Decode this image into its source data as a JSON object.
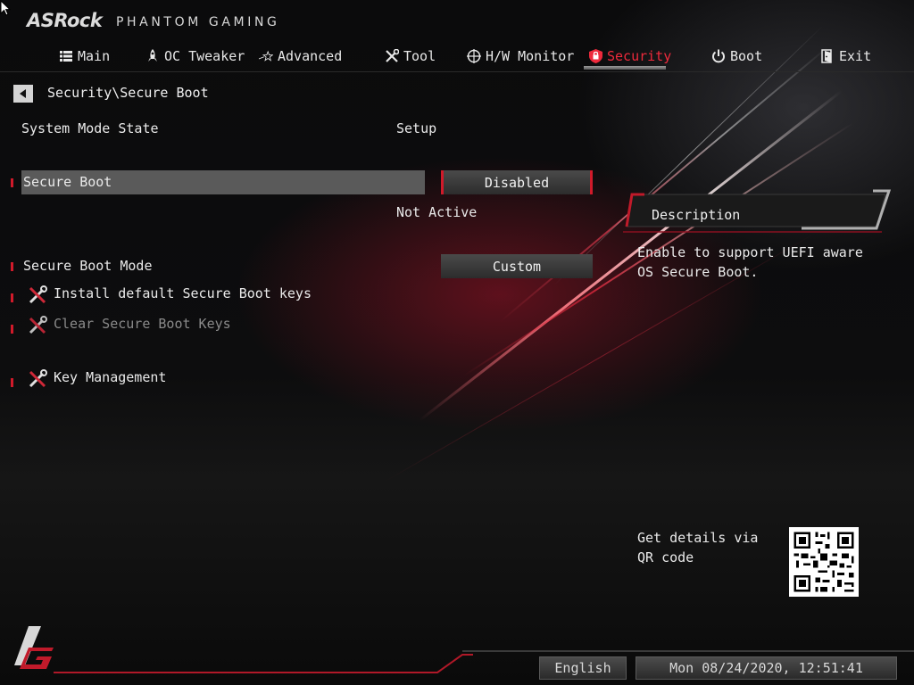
{
  "header": {
    "brand": "ASRock",
    "subtitle": "PHANTOM GAMING"
  },
  "nav": {
    "tabs": [
      {
        "label": "Main",
        "icon": "list-icon"
      },
      {
        "label": "OC Tweaker",
        "icon": "rocket-icon"
      },
      {
        "label": "Advanced",
        "icon": "star-icon"
      },
      {
        "label": "Tool",
        "icon": "tools-icon"
      },
      {
        "label": "H/W Monitor",
        "icon": "crosshair-icon"
      },
      {
        "label": "Security",
        "icon": "shield-icon",
        "active": true
      },
      {
        "label": "Boot",
        "icon": "power-icon"
      },
      {
        "label": "Exit",
        "icon": "exit-door-icon"
      }
    ]
  },
  "breadcrumb": "Security\\Secure Boot",
  "settings": {
    "system_mode_state": {
      "label": "System Mode State",
      "value": "Setup"
    },
    "secure_boot": {
      "label": "Secure Boot",
      "value": "Disabled",
      "status": "Not Active"
    },
    "secure_boot_mode": {
      "label": "Secure Boot Mode",
      "value": "Custom"
    },
    "install_keys": {
      "label": "Install default Secure Boot keys"
    },
    "clear_keys": {
      "label": "Clear Secure Boot Keys"
    },
    "key_management": {
      "label": "Key Management"
    }
  },
  "description": {
    "title": "Description",
    "text": "Enable to support UEFI aware OS Secure Boot."
  },
  "qr": {
    "text": "Get details via QR code"
  },
  "footer": {
    "language": "English",
    "datetime": "Mon 08/24/2020, 12:51:41"
  },
  "colors": {
    "accent": "#ee2a3c",
    "marker": "#d01a2a",
    "selection": "#5a5a5a"
  }
}
